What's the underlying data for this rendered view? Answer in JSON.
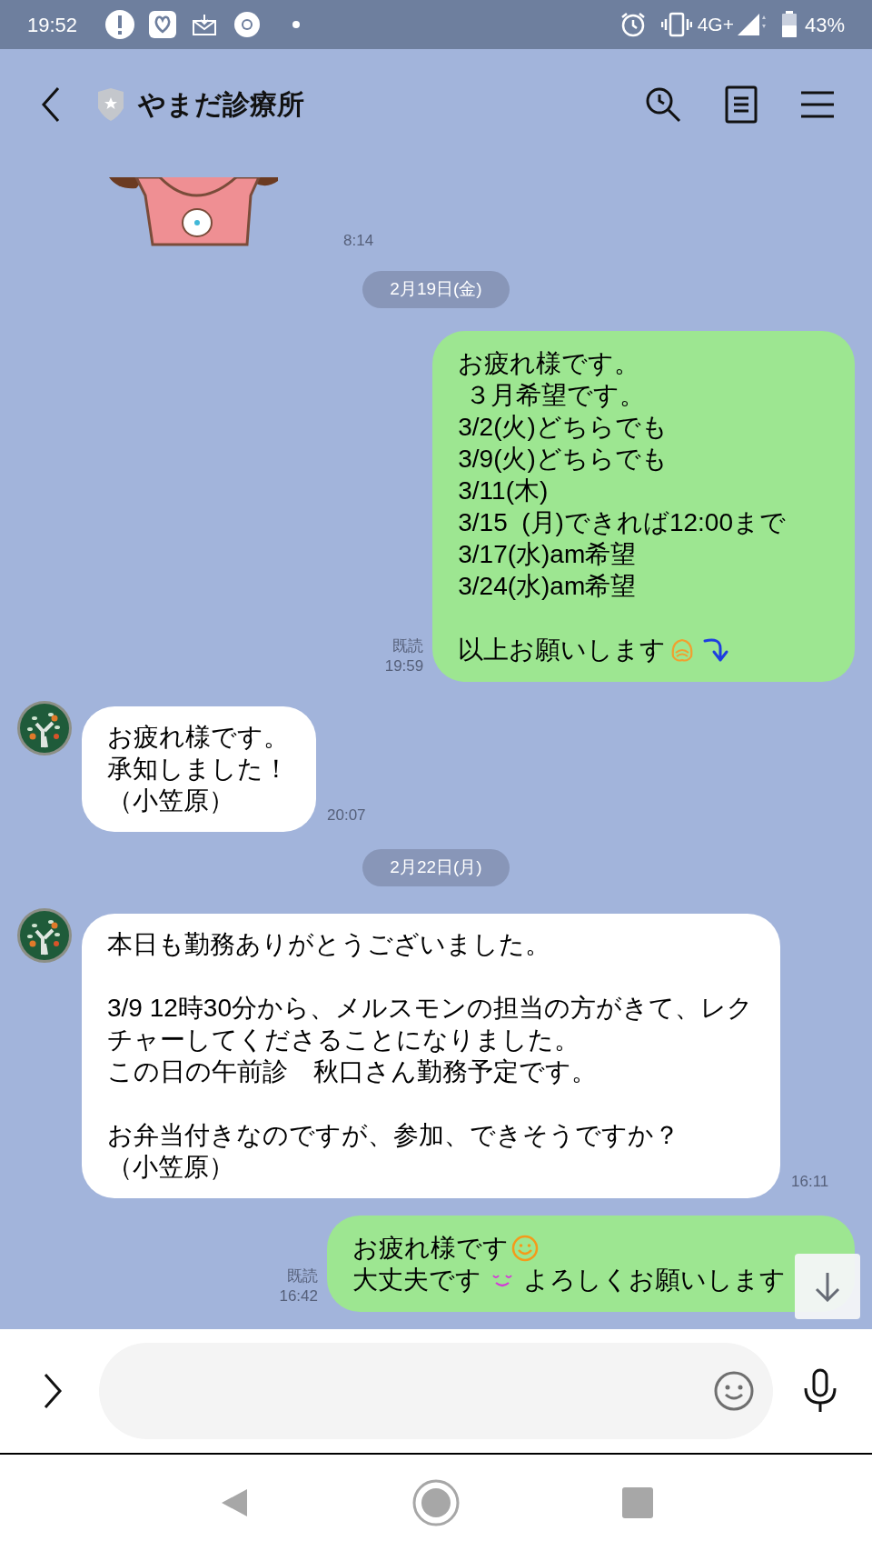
{
  "status_bar": {
    "time": "19:52",
    "network": "4G+",
    "battery": "43%"
  },
  "header": {
    "title": "やまだ診療所"
  },
  "messages": [
    {
      "kind": "sticker",
      "time": "8:14"
    },
    {
      "kind": "date",
      "text": "2月19日(金)"
    },
    {
      "kind": "sent",
      "read": "既読",
      "time": "19:59",
      "paragraphs": [
        [
          "お疲れ様です。",
          " ３月希望です。",
          "3/2(火)どちらでも",
          "3/9(火)どちらでも",
          "3/11(木)",
          "3/15  (月)できれば12:00まで",
          "3/17(水)am希望",
          "3/24(水)am希望"
        ],
        [
          [
            "以上お願いします",
            {
              "kind": "face"
            },
            {
              "kind": "arrow"
            }
          ]
        ]
      ]
    },
    {
      "kind": "received",
      "time": "20:07",
      "paragraphs": [
        [
          "お疲れ様です。",
          "承知しました！",
          "（小笠原）"
        ]
      ]
    },
    {
      "kind": "date",
      "text": "2月22日(月)"
    },
    {
      "kind": "received",
      "time": "16:11",
      "paragraphs": [
        [
          "本日も勤務ありがとうございました。"
        ],
        [
          "3/9 12時30分から、メルスモンの担当の方がきて、レク",
          "チャーしてくださることになりました。",
          "この日の午前診　秋口さん勤務予定です。"
        ],
        [
          "お弁当付きなのですが、参加、できそうですか？",
          "（小笠原）"
        ]
      ]
    },
    {
      "kind": "sent",
      "read": "既読",
      "time": "16:42",
      "paragraphs": [
        [
          [
            "お疲れ様です",
            {
              "kind": "smiley"
            }
          ],
          [
            "大丈夫です",
            {
              "kind": "blush"
            },
            "よろしくお願いします"
          ]
        ]
      ]
    }
  ]
}
